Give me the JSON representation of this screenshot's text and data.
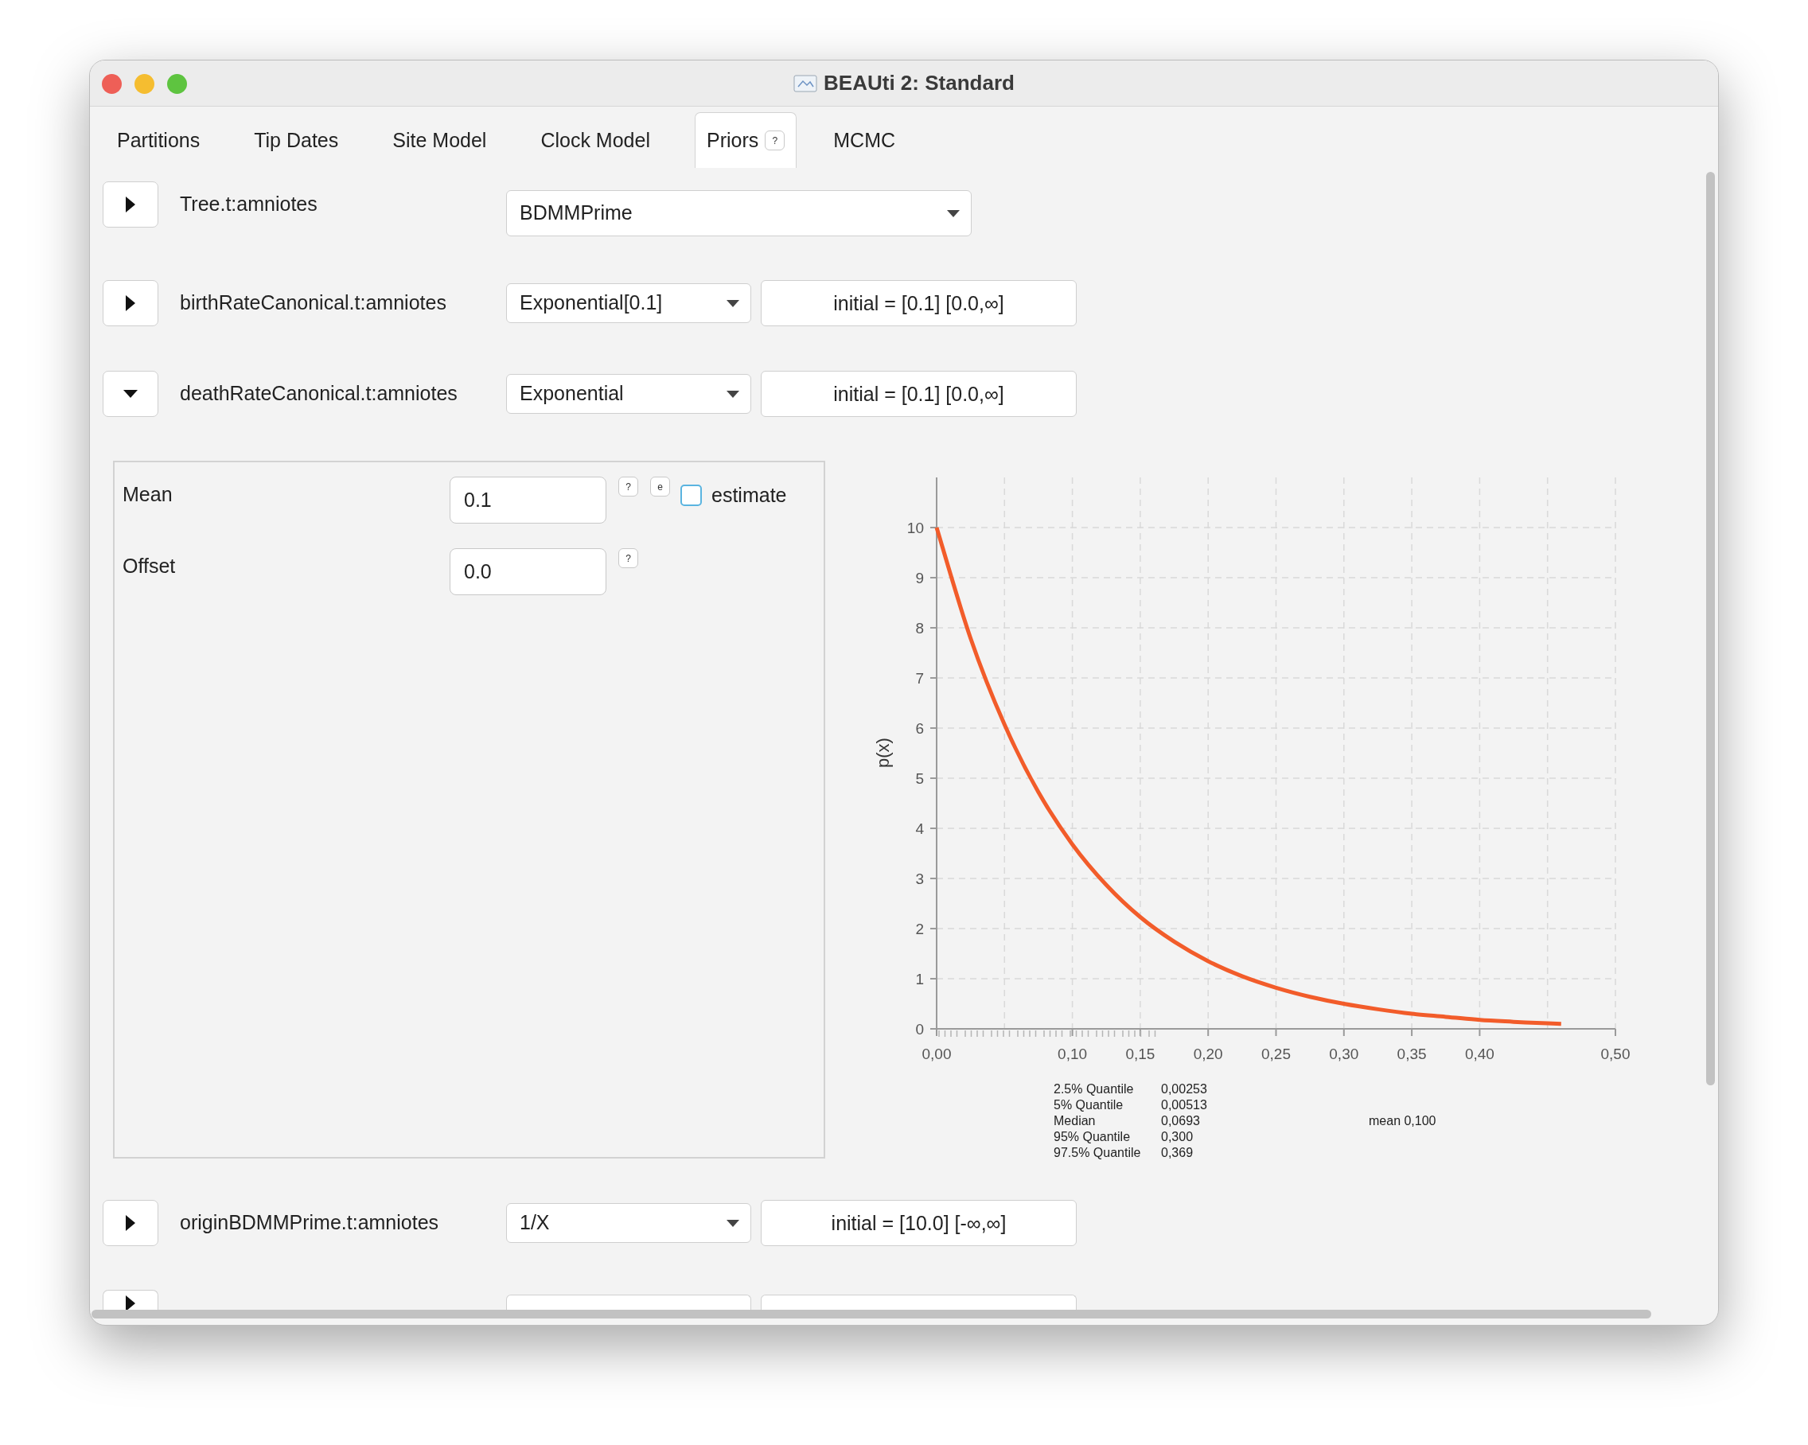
{
  "window": {
    "title": "BEAUti 2: Standard"
  },
  "tabs": [
    {
      "label": "Partitions",
      "selected": false
    },
    {
      "label": "Tip Dates",
      "selected": false
    },
    {
      "label": "Site Model",
      "selected": false
    },
    {
      "label": "Clock Model",
      "selected": false
    },
    {
      "label": "Priors",
      "selected": true,
      "help": "?"
    },
    {
      "label": "MCMC",
      "selected": false
    }
  ],
  "priors": [
    {
      "kind": "tree",
      "label": "Tree.t:amniotes",
      "expanded": false,
      "distribution": "BDMMPrime"
    },
    {
      "kind": "parameter",
      "label": "birthRateCanonical.t:amniotes",
      "expanded": false,
      "distribution": "Exponential[0.1]",
      "initial": "initial = [0.1] [0.0,∞]"
    },
    {
      "kind": "parameter",
      "label": "deathRateCanonical.t:amniotes",
      "expanded": true,
      "distribution": "Exponential",
      "initial": "initial = [0.1] [0.0,∞]",
      "details": {
        "inputs": [
          {
            "label": "Mean",
            "value": "0.1",
            "help": "?",
            "estimate_button": "e",
            "estimate": {
              "label": "estimate",
              "checked": false
            }
          },
          {
            "label": "Offset",
            "value": "0.0",
            "help": "?"
          }
        ],
        "chart_data": {
          "type": "line",
          "ylabel": "p(x)",
          "x": [
            0,
            0.025,
            0.05,
            0.075,
            0.1,
            0.125,
            0.15,
            0.175,
            0.2,
            0.225,
            0.25,
            0.275,
            0.3,
            0.325,
            0.35,
            0.375,
            0.4,
            0.425,
            0.45,
            0.46
          ],
          "series": [
            {
              "color": "#f25c2a",
              "values": [
                10,
                7.79,
                6.07,
                4.72,
                3.68,
                2.87,
                2.23,
                1.74,
                1.35,
                1.05,
                0.82,
                0.64,
                0.5,
                0.39,
                0.3,
                0.24,
                0.18,
                0.14,
                0.11,
                0.1
              ]
            }
          ],
          "xlim": [
            0,
            0.5
          ],
          "ylim": [
            0,
            11
          ],
          "grid": true,
          "xticks": [
            {
              "value": 0,
              "label": "0,00"
            },
            {
              "value": 0.1,
              "label": "0,10"
            },
            {
              "value": 0.15,
              "label": "0,15"
            },
            {
              "value": 0.2,
              "label": "0,20"
            },
            {
              "value": 0.25,
              "label": "0,25"
            },
            {
              "value": 0.3,
              "label": "0,30"
            },
            {
              "value": 0.35,
              "label": "0,35"
            },
            {
              "value": 0.4,
              "label": "0,40"
            },
            {
              "value": 0.5,
              "label": "0,50"
            }
          ],
          "yticks": [
            0,
            1,
            2,
            3,
            4,
            5,
            6,
            7,
            8,
            9,
            10
          ]
        },
        "quantiles": [
          {
            "label": "2.5% Quantile",
            "value": "0,00253"
          },
          {
            "label": "5% Quantile",
            "value": "0,00513"
          },
          {
            "label": "Median",
            "value": "0,0693"
          },
          {
            "label": "95% Quantile",
            "value": "0,300"
          },
          {
            "label": "97.5% Quantile",
            "value": "0,369"
          }
        ],
        "mean": "mean 0,100"
      }
    },
    {
      "kind": "parameter",
      "label": "originBDMMPrime.t:amniotes",
      "expanded": false,
      "distribution": "1/X",
      "initial": "initial = [10.0] [-∞,∞]"
    }
  ],
  "clipped_row": {
    "expanded": false
  }
}
